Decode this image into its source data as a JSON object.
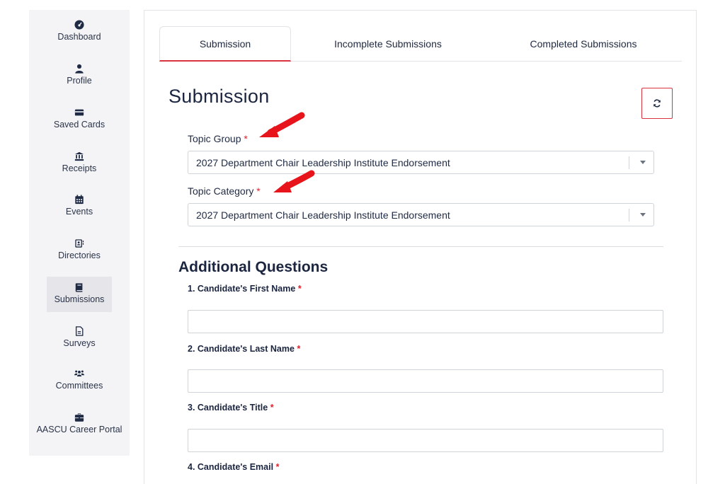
{
  "sidebar": {
    "items": [
      {
        "label": "Dashboard",
        "icon": "dashboard-gauge-icon"
      },
      {
        "label": "Profile",
        "icon": "user-icon"
      },
      {
        "label": "Saved Cards",
        "icon": "credit-card-icon"
      },
      {
        "label": "Receipts",
        "icon": "bank-icon"
      },
      {
        "label": "Events",
        "icon": "calendar-icon"
      },
      {
        "label": "Directories",
        "icon": "address-book-icon"
      },
      {
        "label": "Submissions",
        "icon": "book-icon",
        "active": true
      },
      {
        "label": "Surveys",
        "icon": "document-icon"
      },
      {
        "label": "Committees",
        "icon": "users-icon"
      },
      {
        "label": "AASCU Career Portal",
        "icon": "briefcase-icon"
      }
    ]
  },
  "tabs": [
    {
      "label": "Submission",
      "active": true
    },
    {
      "label": "Incomplete Submissions"
    },
    {
      "label": "Completed Submissions"
    }
  ],
  "page_title": "Submission",
  "refresh_icon": "refresh-icon",
  "topic_group": {
    "label": "Topic Group",
    "required_marker": "*",
    "value": "2027 Department Chair Leadership Institute Endorsement"
  },
  "topic_category": {
    "label": "Topic Category",
    "required_marker": "*",
    "value": "2027 Department Chair Leadership Institute Endorsement"
  },
  "additional_questions": {
    "title": "Additional Questions",
    "questions": [
      {
        "label": "1. Candidate's First Name",
        "required_marker": "*",
        "value": ""
      },
      {
        "label": "2. Candidate's Last Name",
        "required_marker": "*",
        "value": ""
      },
      {
        "label": "3. Candidate's Title",
        "required_marker": "*",
        "value": ""
      },
      {
        "label": "4. Candidate's Email",
        "required_marker": "*",
        "value": ""
      }
    ]
  },
  "colors": {
    "accent_red": "#d9333f",
    "required_red": "#e0202e",
    "annotation_arrow": "#e8141c",
    "sidebar_bg": "#f4f4f6",
    "text_dark": "#1f2a44"
  }
}
